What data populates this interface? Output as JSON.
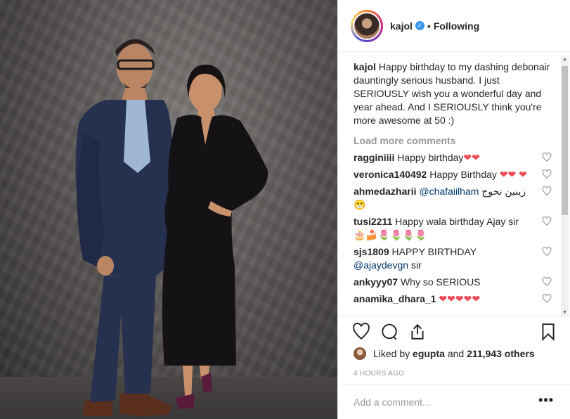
{
  "header": {
    "username": "kajol",
    "separator": "•",
    "follow_status": "Following"
  },
  "caption": {
    "username": "kajol",
    "text": "Happy birthday to my dashing debonair dauntingly serious husband. I just SERIOUSLY wish you a wonderful day and year ahead. And I SERIOUSLY think you're more awesome at 50 :)"
  },
  "load_more": "Load more comments",
  "comments": [
    {
      "user": "ragginiiii",
      "text": "Happy birthday",
      "emoji": "❤❤"
    },
    {
      "user": "veronica140492",
      "text": "Happy Birthday",
      "emoji": "❤❤ ❤"
    },
    {
      "user": "ahmedazharii",
      "mention": "@chafaiilham",
      "text": "زينين نحوج",
      "emoji": "😁"
    },
    {
      "user": "tusi2211",
      "text": "Happy wala birthday Ajay sir",
      "emoji": "🎂🍰🌷🌷🌷🌷"
    },
    {
      "user": "sjs1809",
      "text": "HAPPY BIRTHDAY",
      "mention": "@ajaydevgn",
      "text2": "sir"
    },
    {
      "user": "ankyyy07",
      "text": "Why so SERIOUS"
    },
    {
      "user": "anamika_dhara_1",
      "emoji": "❤❤❤❤❤"
    }
  ],
  "likes": {
    "prefix": "Liked by",
    "user": "egupta",
    "joiner": "and",
    "count": "211,943 others"
  },
  "timestamp": "4 HOURS AGO",
  "add_comment_placeholder": "Add a comment...",
  "more_glyph": "•••",
  "colors": {
    "accent": "#3897f0",
    "heart": "#ed4956",
    "muted": "#999999"
  }
}
